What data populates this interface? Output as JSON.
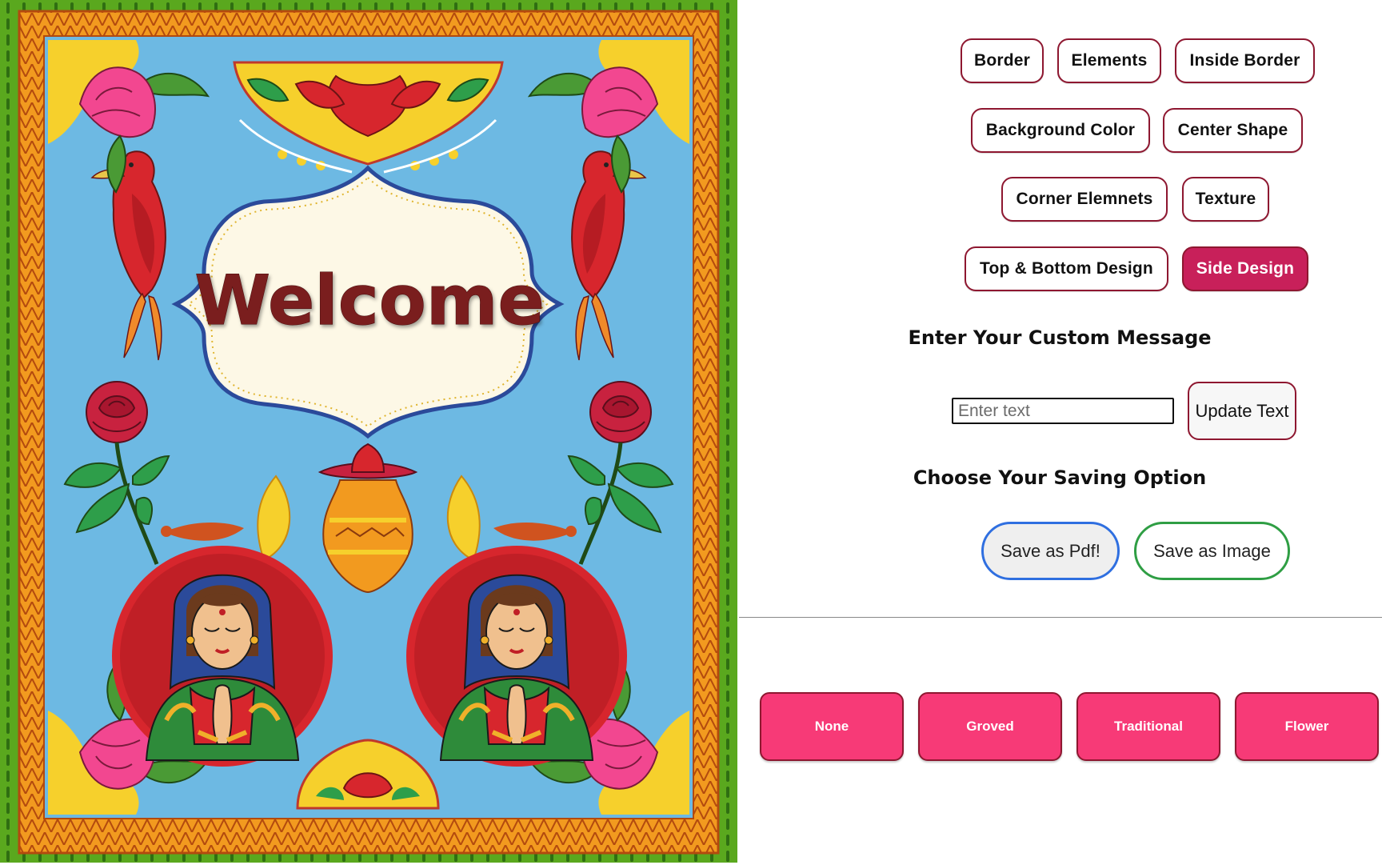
{
  "card": {
    "message": "Welcome",
    "colors": {
      "outer_border": "#5aa81e",
      "inner_border": "#f29a1f",
      "background": "#6db9e3",
      "frame": "#fdf8e6",
      "message": "#7a1e1e"
    }
  },
  "toolbar": {
    "border": "Border",
    "elements": "Elements",
    "inside_border": "Inside Border",
    "background_color": "Background Color",
    "center_shape": "Center Shape",
    "corner_elements": "Corner Elemnets",
    "texture": "Texture",
    "top_bottom_design": "Top & Bottom Design",
    "side_design": "Side Design",
    "active": "Side Design",
    "active_color": "#c8205a",
    "outline_color": "#8e1730"
  },
  "message_section": {
    "heading": "Enter Your Custom Message",
    "input_placeholder": "Enter text",
    "input_value": "",
    "update_label": "Update Text"
  },
  "save_section": {
    "heading": "Choose Your Saving Option",
    "pdf_label": "Save as Pdf!",
    "image_label": "Save as Image"
  },
  "side_design_options": [
    "None",
    "Groved",
    "Traditional",
    "Flower"
  ],
  "side_option_color": "#f73a77"
}
